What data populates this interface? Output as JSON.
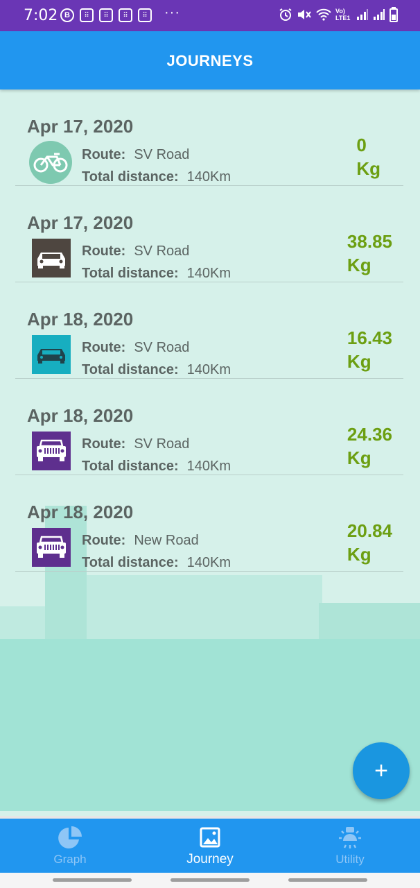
{
  "status_bar": {
    "time": "7:02",
    "left_icons": [
      "b-badge-icon",
      "braille-icon",
      "braille-icon",
      "braille-icon",
      "braille-icon"
    ],
    "more": "···",
    "network_label": "Vo) LTE1",
    "battery": "7"
  },
  "app_bar": {
    "title": "JOURNEYS"
  },
  "journeys": [
    {
      "date": "Apr 17, 2020",
      "icon": "bicycle-icon",
      "icon_bg": "#7ec9b0",
      "route_label": "Route:",
      "route": "SV Road",
      "distance_label": "Total distance:",
      "distance": "140Km",
      "co2_value": "0",
      "co2_unit": "Kg"
    },
    {
      "date": "Apr 17, 2020",
      "icon": "car-icon",
      "icon_bg": "#4e4640",
      "route_label": "Route:",
      "route": "SV Road",
      "distance_label": "Total distance:",
      "distance": "140Km",
      "co2_value": "38.85",
      "co2_unit": "Kg"
    },
    {
      "date": "Apr 18, 2020",
      "icon": "car-icon",
      "icon_bg": "#17aec0",
      "route_label": "Route:",
      "route": "SV Road",
      "distance_label": "Total distance:",
      "distance": "140Km",
      "co2_value": "16.43",
      "co2_unit": "Kg"
    },
    {
      "date": "Apr 18, 2020",
      "icon": "jeep-icon",
      "icon_bg": "#5e2f8e",
      "route_label": "Route:",
      "route": "SV Road",
      "distance_label": "Total distance:",
      "distance": "140Km",
      "co2_value": "24.36",
      "co2_unit": "Kg"
    },
    {
      "date": "Apr 18, 2020",
      "icon": "jeep-icon",
      "icon_bg": "#5e2f8e",
      "route_label": "Route:",
      "route": "New Road",
      "distance_label": "Total distance:",
      "distance": "140Km",
      "co2_value": "20.84",
      "co2_unit": "Kg"
    }
  ],
  "fab": {
    "label": "+"
  },
  "bottom_nav": [
    {
      "label": "Graph",
      "icon": "pie-chart-icon",
      "active": false
    },
    {
      "label": "Journey",
      "icon": "image-icon",
      "active": true
    },
    {
      "label": "Utility",
      "icon": "bulb-icon",
      "active": false
    }
  ],
  "colors": {
    "status_bar": "#6a36b5",
    "app_bar": "#2196ef",
    "accent_green": "#6c9f12",
    "fab": "#1a96e0"
  }
}
